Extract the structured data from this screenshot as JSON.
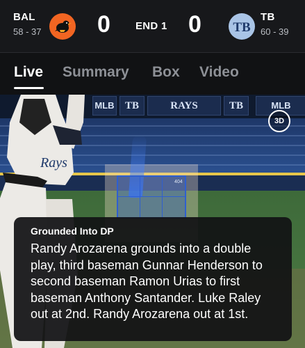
{
  "scoreboard": {
    "away": {
      "abbr": "BAL",
      "record": "58 - 37",
      "score": "0",
      "logo_color": "#f26522"
    },
    "home": {
      "abbr": "TB",
      "record": "60 - 39",
      "score": "0",
      "logo_color": "#a9c4e6"
    },
    "inning": "END 1"
  },
  "tabs": [
    {
      "label": "Live",
      "active": true
    },
    {
      "label": "Summary",
      "active": false
    },
    {
      "label": "Box",
      "active": false
    },
    {
      "label": "Video",
      "active": false
    }
  ],
  "stage": {
    "signs": [
      "TB",
      "RAYS",
      "TB",
      "MLB",
      "MLB"
    ],
    "three_d_label": "3D",
    "pitch_speed": "404"
  },
  "play_card": {
    "title": "Grounded Into DP",
    "text": "Randy Arozarena grounds into a double play, third baseman Gunnar Henderson to second baseman Ramon Urias to first baseman Anthony Santander. Luke Raley out at 2nd. Randy Arozarena out at 1st."
  }
}
